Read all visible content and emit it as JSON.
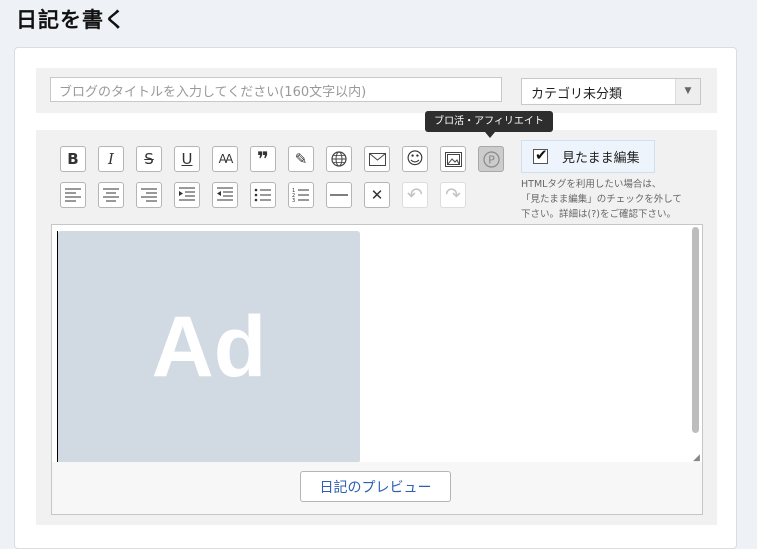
{
  "page": {
    "title": "日記を書く"
  },
  "title_field": {
    "placeholder": "ブログのタイトルを入力してください(160文字以内)",
    "value": ""
  },
  "category": {
    "selected": "カテゴリ未分類"
  },
  "toolbar": {
    "tooltip": "ブロ活・アフィリエイト",
    "row1": [
      {
        "icon": "bold-icon",
        "glyph": "B"
      },
      {
        "icon": "italic-icon",
        "glyph": "I"
      },
      {
        "icon": "strikethrough-icon",
        "glyph": "S"
      },
      {
        "icon": "underline-icon",
        "glyph": "U"
      },
      {
        "icon": "font-size-icon",
        "glyph": "AA"
      },
      {
        "icon": "blockquote-icon",
        "glyph": "❞"
      },
      {
        "icon": "edit-document-icon",
        "glyph": "✎"
      },
      {
        "icon": "globe-link-icon",
        "glyph": "🌐"
      },
      {
        "icon": "mail-icon",
        "glyph": "✉"
      },
      {
        "icon": "emoji-icon",
        "glyph": "☺"
      },
      {
        "icon": "image-icon",
        "glyph": "▣"
      },
      {
        "icon": "affiliate-p-icon",
        "glyph": "ⓟ"
      }
    ],
    "row2": [
      {
        "icon": "align-left-icon"
      },
      {
        "icon": "align-center-icon"
      },
      {
        "icon": "align-right-icon"
      },
      {
        "icon": "indent-icon"
      },
      {
        "icon": "outdent-icon"
      },
      {
        "icon": "bullet-list-icon"
      },
      {
        "icon": "numbered-list-icon"
      },
      {
        "icon": "horizontal-rule-icon"
      },
      {
        "icon": "clear-format-icon",
        "glyph": "✕"
      },
      {
        "icon": "undo-icon",
        "glyph": "↶"
      },
      {
        "icon": "redo-icon",
        "glyph": "↷"
      }
    ]
  },
  "wysiwyg": {
    "label": "見たまま編集",
    "checked": true,
    "note_line1": "HTMLタグを利用したい場合は、",
    "note_line2": "「見たまま編集」のチェックを外して",
    "note_line3": "下さい。詳細は(?)をご確認下さい。"
  },
  "editor": {
    "ad_text": "Ad"
  },
  "preview": {
    "button_label": "日記のプレビュー"
  },
  "colors": {
    "ad_background": "#d1d9e3",
    "preview_link": "#2d5fb3",
    "tooltip_bg": "#2e2e2e"
  }
}
